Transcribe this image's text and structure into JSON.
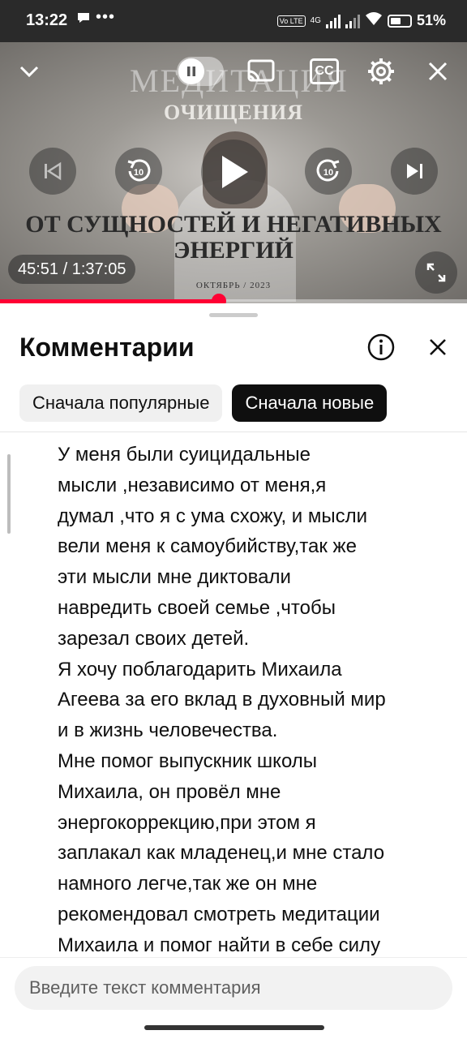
{
  "status_bar": {
    "time": "13:22",
    "dots": "•••",
    "battery": "51%",
    "network": "4G",
    "lte": "Vo LTE"
  },
  "video": {
    "title_line1": "МЕДИТАЦИЯ",
    "title_line2": "ОЧИЩЕНИЯ",
    "title_line3": "ОТ СУЩНОСТЕЙ  И НЕГАТИВНЫХ",
    "title_line4": "ЭНЕРГИЙ",
    "date": "ОКТЯБРЬ / 2023",
    "time_display": "45:51 / 1:37:05",
    "progress_fraction": 0.4695,
    "rewind_label": "10",
    "forward_label": "10",
    "cc_label": "CC"
  },
  "comments": {
    "title": "Комментарии",
    "chips": [
      {
        "label": "Сначала популярные",
        "selected": false
      },
      {
        "label": "Сначала новые",
        "selected": true
      }
    ],
    "lines": [
      "У меня были суицидальные",
      "мысли ,независимо от меня,я",
      "думал ,что я с ума схожу, и мысли",
      "вели меня к самоубийству,так же",
      "эти мысли мне диктовали",
      "навредить своей семье ,чтобы",
      "зарезал своих детей.",
      "Я хочу поблагодарить Михаила",
      "Агеева за его вклад в духовный мир",
      "и в жизнь человечества.",
      "Мне помог выпускник школы",
      "Михаила, он провёл мне",
      "энергокоррекцию,при этом я",
      "заплакал как младенец,и мне стало",
      "намного легче,так же он мне",
      "рекомендовал  смотреть медитации",
      "Михаила и помог найти в себе силу"
    ],
    "input_placeholder": "Введите текст комментария"
  },
  "colors": {
    "accent": "#ff0033",
    "chip_selected": "#0f0f0f",
    "chip_unselected": "#f0f0f0"
  }
}
